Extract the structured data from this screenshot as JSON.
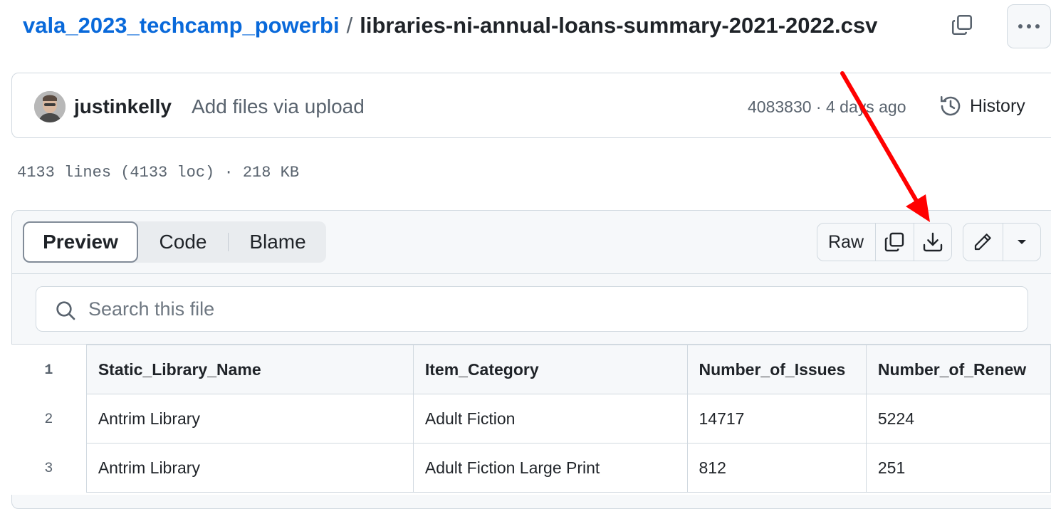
{
  "breadcrumb": {
    "repo": "vala_2023_techcamp_powerbi",
    "separator": "/",
    "file": "libraries-ni-annual-loans-summary-2021-2022.csv"
  },
  "commit": {
    "author": "justinkelly",
    "message": "Add files via upload",
    "meta": "4083830 · 4 days ago",
    "history_label": "History"
  },
  "file_info": "4133 lines (4133 loc) · 218 KB",
  "view_tabs": {
    "preview": "Preview",
    "code": "Code",
    "blame": "Blame"
  },
  "actions": {
    "raw": "Raw"
  },
  "search": {
    "placeholder": "Search this file"
  },
  "table": {
    "header_line": "1",
    "headers": [
      "Static_Library_Name",
      "Item_Category",
      "Number_of_Issues",
      "Number_of_Renew"
    ],
    "rows": [
      {
        "line": "2",
        "cells": [
          "Antrim Library",
          "Adult Fiction",
          "14717",
          "5224"
        ]
      },
      {
        "line": "3",
        "cells": [
          "Antrim Library",
          "Adult Fiction Large Print",
          "812",
          "251"
        ]
      }
    ]
  },
  "colors": {
    "link": "#0969da",
    "annotation_arrow": "#ff0000",
    "border": "#d1d9e0",
    "muted": "#59636e"
  }
}
